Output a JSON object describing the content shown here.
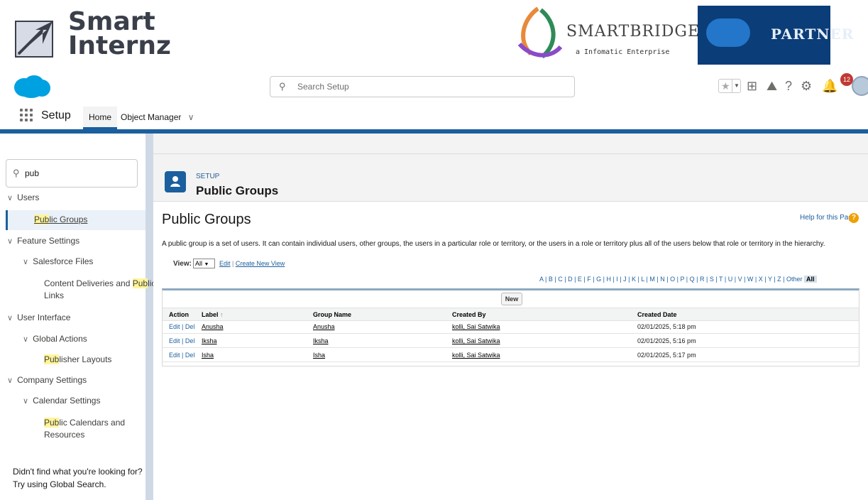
{
  "branding": {
    "smartinternz_line1": "Smart",
    "smartinternz_line2": "Internz",
    "smartbridge_name": "SMARTBRIDGE",
    "smartbridge_tagline": "a Infomatic Enterprise",
    "partner_label": "PARTNER"
  },
  "header": {
    "search_placeholder": "Search Setup",
    "notification_count": "12"
  },
  "nav": {
    "app_name": "Setup",
    "tabs": [
      {
        "label": "Home"
      },
      {
        "label": "Object Manager"
      }
    ]
  },
  "sidebar": {
    "quick_find_value": "pub",
    "tree": {
      "users": "Users",
      "public_groups_a": "Pub",
      "public_groups_b": "lic Groups",
      "feature_settings": "Feature Settings",
      "salesforce_files": "Salesforce Files",
      "content_deliveries_a": "Content Deliveries and ",
      "content_deliveries_b": "Pub",
      "content_deliveries_c": "lic",
      "content_deliveries_d": "Links",
      "user_interface": "User Interface",
      "global_actions": "Global Actions",
      "publisher_a": "Pub",
      "publisher_b": "lisher Layouts",
      "company_settings": "Company Settings",
      "calendar_settings": "Calendar Settings",
      "public_cal_a": "Pub",
      "public_cal_b": "lic Calendars and",
      "public_cal_c": "Resources"
    },
    "not_found_line1": "Didn't find what you're looking for?",
    "not_found_line2": "Try using Global Search."
  },
  "page_header": {
    "eyebrow": "SETUP",
    "title": "Public Groups"
  },
  "content": {
    "title": "Public Groups",
    "help_link": "Help for this Page",
    "description": "A public group is a set of users. It can contain individual users, other groups, the users in a particular role or territory, or the users in a role or territory plus all of the users below that role or territory in the hierarchy.",
    "view_label": "View:",
    "view_value": "All",
    "edit_link": "Edit",
    "create_view_link": "Create New View",
    "alphabet": [
      "A",
      "B",
      "C",
      "D",
      "E",
      "F",
      "G",
      "H",
      "I",
      "J",
      "K",
      "L",
      "M",
      "N",
      "O",
      "P",
      "Q",
      "R",
      "S",
      "T",
      "U",
      "V",
      "W",
      "X",
      "Y",
      "Z",
      "Other"
    ],
    "alphabet_current": "All",
    "new_button": "New",
    "columns": {
      "action": "Action",
      "label": "Label",
      "sort_indicator": "↑",
      "group_name": "Group Name",
      "created_by": "Created By",
      "created_date": "Created Date"
    },
    "rows": [
      {
        "edit": "Edit",
        "sep": "|",
        "del": "Del",
        "label": "Anusha",
        "group_name": "Anusha",
        "created_by": "kolli, Sai Satwika",
        "created_date": "02/01/2025, 5:18 pm"
      },
      {
        "edit": "Edit",
        "sep": "|",
        "del": "Del",
        "label": "Iksha",
        "group_name": "Iksha",
        "created_by": "kolli, Sai Satwika",
        "created_date": "02/01/2025, 5:16 pm"
      },
      {
        "edit": "Edit",
        "sep": "|",
        "del": "Del",
        "label": "Isha",
        "group_name": "Isha",
        "created_by": "kolli, Sai Satwika",
        "created_date": "02/01/2025, 5:17 pm"
      }
    ]
  },
  "colors": {
    "brand_blue": "#1b5f9e",
    "highlight": "#fff59a",
    "salesforce_cloud": "#00a1e0",
    "badge_red": "#c23934"
  }
}
